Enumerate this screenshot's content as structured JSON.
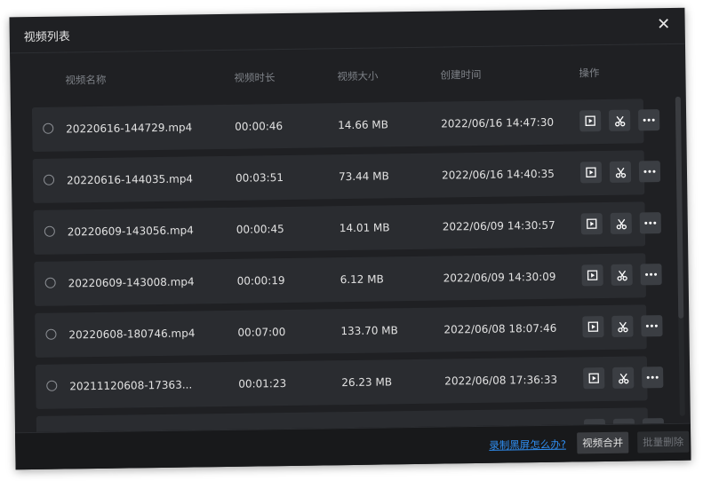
{
  "window": {
    "title": "视频列表",
    "close_glyph": "✕"
  },
  "columns": {
    "name": "视频名称",
    "duration": "视频时长",
    "size": "视频大小",
    "created": "创建时间",
    "actions": "操作"
  },
  "rows": [
    {
      "name": "20220616-144729.mp4",
      "duration": "00:00:46",
      "size": "14.66 MB",
      "created": "2022/06/16 14:47:30"
    },
    {
      "name": "20220616-144035.mp4",
      "duration": "00:03:51",
      "size": "73.44 MB",
      "created": "2022/06/16 14:40:35"
    },
    {
      "name": "20220609-143056.mp4",
      "duration": "00:00:45",
      "size": "14.01 MB",
      "created": "2022/06/09 14:30:57"
    },
    {
      "name": "20220609-143008.mp4",
      "duration": "00:00:19",
      "size": "6.12 MB",
      "created": "2022/06/09 14:30:09"
    },
    {
      "name": "20220608-180746.mp4",
      "duration": "00:07:00",
      "size": "133.70 MB",
      "created": "2022/06/08 18:07:46"
    },
    {
      "name": "20211120608-17363...",
      "duration": "00:01:23",
      "size": "26.23 MB",
      "created": "2022/06/08 17:36:33"
    },
    {
      "name": "",
      "duration": "",
      "size": "",
      "created": ""
    }
  ],
  "icons": {
    "play": "play-icon",
    "cut": "scissors-icon",
    "more": "more-icon",
    "close": "close-icon",
    "radio": "radio-icon"
  },
  "footer": {
    "help_link": "录制黑屏怎么办?",
    "merge_button": "视频合并",
    "delete_button": "批量删除"
  },
  "colors": {
    "background": "#1f2023",
    "row": "#2a2c30",
    "link": "#2f8ef2",
    "action_button": "#3b3e43"
  }
}
